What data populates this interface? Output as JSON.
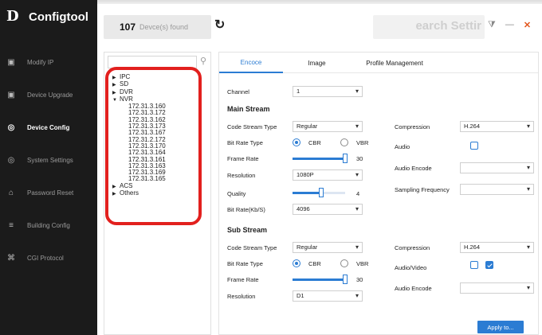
{
  "app": {
    "name": "Configtool",
    "logo_glyph": "D"
  },
  "sidebar": {
    "items": [
      {
        "label": "Modify IP",
        "icon": "ip-icon",
        "glyph": "▣"
      },
      {
        "label": "Device Upgrade",
        "icon": "upgrade-icon",
        "glyph": "▣"
      },
      {
        "label": "Device Config",
        "icon": "config-icon",
        "glyph": "◎"
      },
      {
        "label": "System Settings",
        "icon": "settings-icon",
        "glyph": "◎"
      },
      {
        "label": "Password Reset",
        "icon": "lock-icon",
        "glyph": "⌂"
      },
      {
        "label": "Building Config",
        "icon": "building-icon",
        "glyph": "≡"
      },
      {
        "label": "CGI Protocol",
        "icon": "protocol-icon",
        "glyph": "⌘"
      }
    ],
    "active_index": 2
  },
  "topbar": {
    "device_count": "107",
    "device_count_label": "Devce(s) found",
    "search_placeholder": "earch Settir",
    "refresh_glyph": "↻",
    "filter_glyph": "⧩",
    "minimize_glyph": "—",
    "close_glyph": "✕"
  },
  "tree": {
    "search_icon_glyph": "⚲",
    "groups": [
      {
        "label": "IPC",
        "expanded": false
      },
      {
        "label": "SD",
        "expanded": false
      },
      {
        "label": "DVR",
        "expanded": false
      },
      {
        "label": "NVR",
        "expanded": true,
        "children": [
          "172.31.3.160",
          "172.31.3.172",
          "172.31.3.162",
          "172.31.3.173",
          "172.31.3.167",
          "172.31.2.172",
          "172.31.3.170",
          "172.31.3.164",
          "172.31.3.161",
          "172.31.3.163",
          "172.31.3.169",
          "172.31.3.165"
        ]
      },
      {
        "label": "ACS",
        "expanded": false
      },
      {
        "label": "Others",
        "expanded": false
      }
    ],
    "selected": "172.31.3.161"
  },
  "tabs": [
    "Encoce",
    "Image",
    "Profile Management"
  ],
  "active_tab": "Encoce",
  "form": {
    "channel_label": "Channel",
    "channel_value": "1",
    "main_stream": {
      "title": "Main Stream",
      "code_stream_type_label": "Code Stream Type",
      "code_stream_type_value": "Regular",
      "bit_rate_type_label": "Bit Rate Type",
      "cbr": "CBR",
      "vbr": "VBR",
      "bit_rate_type_selected": "CBR",
      "frame_rate_label": "Frame Rate",
      "frame_rate_value": "30",
      "frame_rate_fraction": 1.0,
      "resolution_label": "Resolution",
      "resolution_value": "1080P",
      "quality_label": "Quality",
      "quality_value": "4",
      "quality_fraction": 0.55,
      "bit_rate_label": "Bit Rate(Kb/S)",
      "bit_rate_value": "4096",
      "compression_label": "Compression",
      "compression_value": "H.264",
      "audio_label": "Audio",
      "audio_checked": false,
      "audio_encode_label": "Audio Encode",
      "audio_encode_value": "",
      "sampling_frequency_label": "Sampling Frequency",
      "sampling_frequency_value": ""
    },
    "sub_stream": {
      "title": "Sub Stream",
      "code_stream_type_label": "Code Stream Type",
      "code_stream_type_value": "Regular",
      "bit_rate_type_label": "Bit Rate Type",
      "cbr": "CBR",
      "vbr": "VBR",
      "bit_rate_type_selected": "CBR",
      "frame_rate_label": "Frame Rate",
      "frame_rate_value": "30",
      "frame_rate_fraction": 1.0,
      "resolution_label": "Resolution",
      "resolution_value": "D1",
      "compression_label": "Compression",
      "compression_value": "H.264",
      "audio_video_label": "Audio/Video",
      "audio_video_checked": true,
      "audio_encode_label": "Audio Encode",
      "audio_encode_value": ""
    },
    "apply_label": "Apply to..."
  },
  "colors": {
    "accent": "#2b7cd3",
    "highlight": "#e2201e",
    "sidebar_bg": "#1b1b1b",
    "close": "#e2571e"
  }
}
